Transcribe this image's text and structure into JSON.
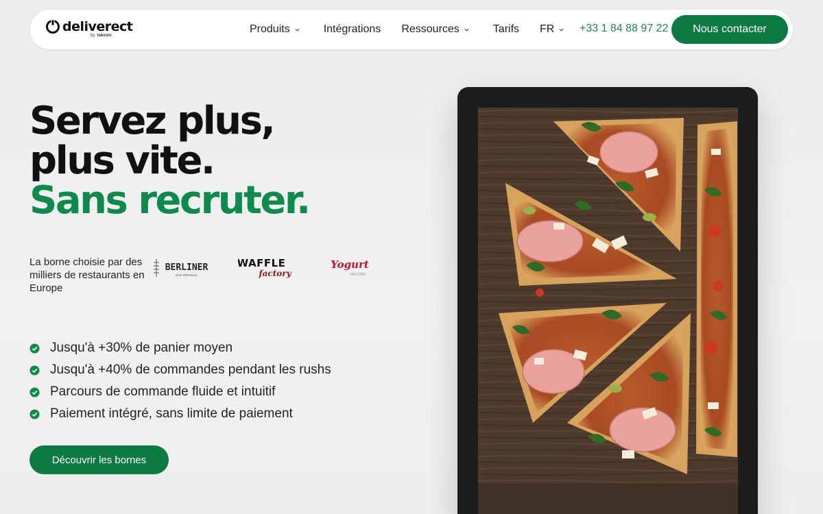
{
  "brand": {
    "logo_text": "deliverect",
    "logo_sub_prefix": "by",
    "logo_sub_brand": "tabesto"
  },
  "nav": {
    "items": [
      {
        "label": "Produits",
        "has_dropdown": true
      },
      {
        "label": "Intégrations",
        "has_dropdown": false
      },
      {
        "label": "Ressources",
        "has_dropdown": true
      },
      {
        "label": "Tarifs",
        "has_dropdown": false
      },
      {
        "label": "FR",
        "has_dropdown": true
      }
    ],
    "phone": "+33 1 84 88 97 22",
    "cta_label": "Nous contacter"
  },
  "hero": {
    "title_line1": "Servez plus,",
    "title_line2": "plus vite.",
    "title_line3": "Sans recruter.",
    "tagline": "La borne choisie par des milliers de restaurants en Europe",
    "partners": [
      {
        "name": "BERLINER",
        "sub": "DAS ORIGINAL"
      },
      {
        "name": "WAFFLE",
        "sub": "factory"
      },
      {
        "name": "Yogurt",
        "sub": "FACTORY"
      }
    ],
    "features": [
      "Jusqu'à +30% de panier moyen",
      "Jusqu'à +40% de commandes pendant les rushs",
      "Parcours de commande fluide et intuitif",
      "Paiement intégré, sans limite de paiement"
    ],
    "button_label": "Découvrir les bornes"
  },
  "colors": {
    "accent": "#0d7a43",
    "title_green": "#0d8a4c",
    "phone_green": "#1a8a4a",
    "yogurt_red": "#c8102e"
  },
  "icons": {
    "logo": "deliverect-logo-icon",
    "dropdown": "chevron-down-icon",
    "feature": "check-circle-icon"
  }
}
